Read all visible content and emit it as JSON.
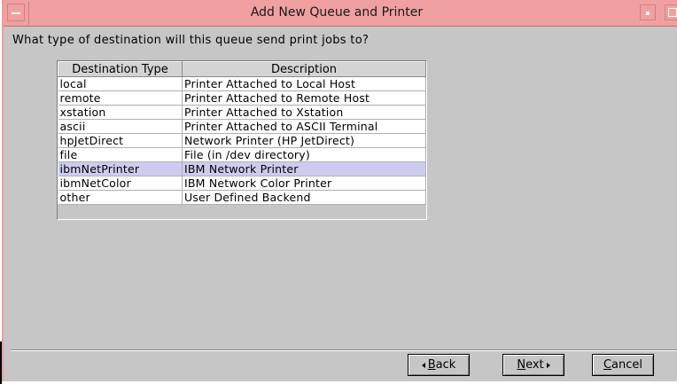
{
  "window": {
    "title": "Add New Queue and Printer"
  },
  "prompt": "What type of destination will this queue send print jobs to?",
  "table": {
    "headers": [
      "Destination Type",
      "Description"
    ],
    "rows": [
      {
        "type": "local",
        "description": "Printer Attached to Local Host"
      },
      {
        "type": "remote",
        "description": "Printer Attached to Remote Host"
      },
      {
        "type": "xstation",
        "description": "Printer Attached to Xstation"
      },
      {
        "type": "ascii",
        "description": "Printer Attached to ASCII Terminal"
      },
      {
        "type": "hpJetDirect",
        "description": "Network Printer (HP JetDirect)"
      },
      {
        "type": "file",
        "description": "File (in /dev directory)"
      },
      {
        "type": "ibmNetPrinter",
        "description": "IBM Network Printer"
      },
      {
        "type": "ibmNetColor",
        "description": "IBM Network Color Printer"
      },
      {
        "type": "other",
        "description": "User Defined Backend"
      }
    ],
    "selected_index": 6
  },
  "buttons": {
    "back_mnemonic": "B",
    "back_rest": "ack",
    "next_mnemonic": "N",
    "next_rest": "ext",
    "cancel_mnemonic": "C",
    "cancel_rest": "ancel"
  },
  "colors": {
    "titlebar": "#f0a0a0",
    "selection": "#ccccf0",
    "dialog_bg": "#c6c6c6"
  }
}
